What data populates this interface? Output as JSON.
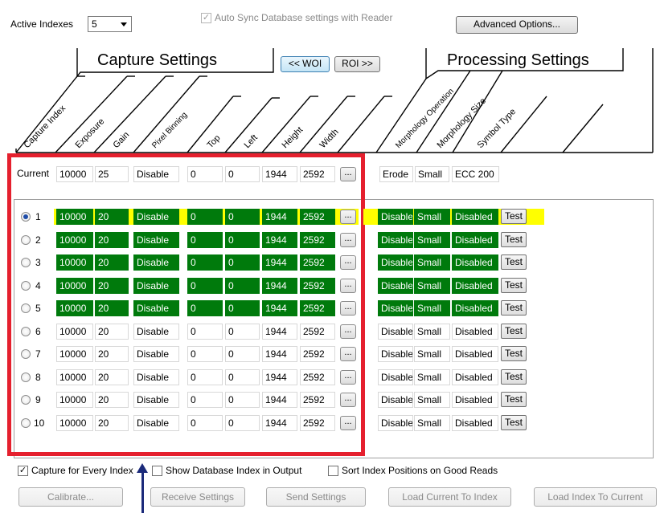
{
  "top_bar": {
    "active_indexes_label": "Active Indexes",
    "active_indexes_value": "5",
    "auto_sync_label": "Auto Sync Database settings with Reader",
    "auto_sync_check": "✓",
    "advanced_options_label": "Advanced Options..."
  },
  "headers": {
    "capture_settings": "Capture Settings",
    "processing_settings": "Processing Settings",
    "woi_button": "<< WOI",
    "roi_button": "ROI >>",
    "columns": [
      "Capture Index",
      "Exposure",
      "Gain",
      "Pixel Binning",
      "Top",
      "Left",
      "Height",
      "Width",
      "Morphology Operation",
      "Morphology Size",
      "Symbol Type"
    ]
  },
  "current_row": {
    "label": "Current",
    "exposure": "10000",
    "gain": "25",
    "binning": "Disable",
    "top": "0",
    "left": "0",
    "height": "1944",
    "width": "2592",
    "dots": "...",
    "morph_op": "Erode",
    "morph_size": "Small",
    "symbol_type": "ECC 200"
  },
  "rows": [
    {
      "num": "1",
      "exposure": "10000",
      "gain": "20",
      "binning": "Disable",
      "top": "0",
      "left": "0",
      "height": "1944",
      "width": "2592",
      "dots": "...",
      "morph_op": "Disable",
      "morph_size": "Small",
      "symbol_type": "Disabled",
      "test": "Test"
    },
    {
      "num": "2",
      "exposure": "10000",
      "gain": "20",
      "binning": "Disable",
      "top": "0",
      "left": "0",
      "height": "1944",
      "width": "2592",
      "dots": "...",
      "morph_op": "Disable",
      "morph_size": "Small",
      "symbol_type": "Disabled",
      "test": "Test"
    },
    {
      "num": "3",
      "exposure": "10000",
      "gain": "20",
      "binning": "Disable",
      "top": "0",
      "left": "0",
      "height": "1944",
      "width": "2592",
      "dots": "...",
      "morph_op": "Disable",
      "morph_size": "Small",
      "symbol_type": "Disabled",
      "test": "Test"
    },
    {
      "num": "4",
      "exposure": "10000",
      "gain": "20",
      "binning": "Disable",
      "top": "0",
      "left": "0",
      "height": "1944",
      "width": "2592",
      "dots": "...",
      "morph_op": "Disable",
      "morph_size": "Small",
      "symbol_type": "Disabled",
      "test": "Test"
    },
    {
      "num": "5",
      "exposure": "10000",
      "gain": "20",
      "binning": "Disable",
      "top": "0",
      "left": "0",
      "height": "1944",
      "width": "2592",
      "dots": "...",
      "morph_op": "Disable",
      "morph_size": "Small",
      "symbol_type": "Disabled",
      "test": "Test"
    },
    {
      "num": "6",
      "exposure": "10000",
      "gain": "20",
      "binning": "Disable",
      "top": "0",
      "left": "0",
      "height": "1944",
      "width": "2592",
      "dots": "...",
      "morph_op": "Disable",
      "morph_size": "Small",
      "symbol_type": "Disabled",
      "test": "Test"
    },
    {
      "num": "7",
      "exposure": "10000",
      "gain": "20",
      "binning": "Disable",
      "top": "0",
      "left": "0",
      "height": "1944",
      "width": "2592",
      "dots": "...",
      "morph_op": "Disable",
      "morph_size": "Small",
      "symbol_type": "Disabled",
      "test": "Test"
    },
    {
      "num": "8",
      "exposure": "10000",
      "gain": "20",
      "binning": "Disable",
      "top": "0",
      "left": "0",
      "height": "1944",
      "width": "2592",
      "dots": "...",
      "morph_op": "Disable",
      "morph_size": "Small",
      "symbol_type": "Disabled",
      "test": "Test"
    },
    {
      "num": "9",
      "exposure": "10000",
      "gain": "20",
      "binning": "Disable",
      "top": "0",
      "left": "0",
      "height": "1944",
      "width": "2592",
      "dots": "...",
      "morph_op": "Disable",
      "morph_size": "Small",
      "symbol_type": "Disabled",
      "test": "Test"
    },
    {
      "num": "10",
      "exposure": "10000",
      "gain": "20",
      "binning": "Disable",
      "top": "0",
      "left": "0",
      "height": "1944",
      "width": "2592",
      "dots": "...",
      "morph_op": "Disable",
      "morph_size": "Small",
      "symbol_type": "Disabled",
      "test": "Test"
    }
  ],
  "selected_row": "1",
  "active_row_count": 5,
  "options": {
    "capture_every_index": "Capture for Every Index",
    "capture_every_index_check": "✓",
    "show_db_index": "Show Database Index in Output",
    "sort_index": "Sort Index Positions on Good Reads"
  },
  "bottom_buttons": {
    "calibrate": "Calibrate...",
    "receive": "Receive Settings",
    "send": "Send Settings",
    "load_current_to_index": "Load Current To Index",
    "load_index_to_current": "Load Index To Current"
  },
  "colors": {
    "active_green": "#007a0c",
    "selected_yellow": "#ffff00",
    "highlight_red": "#e5202e",
    "arrow_blue": "#1b2a7a"
  }
}
